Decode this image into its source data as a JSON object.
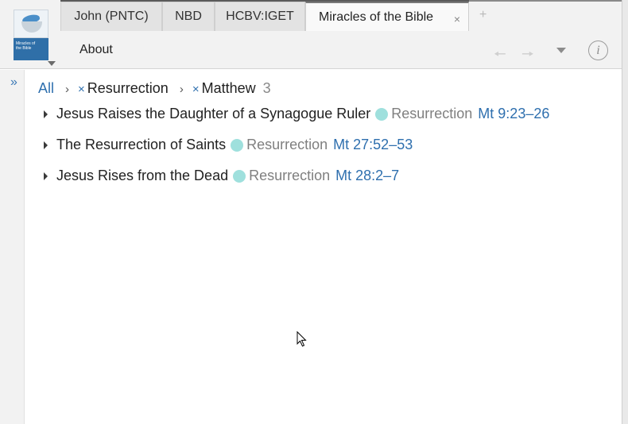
{
  "tabs": [
    {
      "label": "John (PNTC)"
    },
    {
      "label": "NBD"
    },
    {
      "label": "HCBV:IGET"
    },
    {
      "label": "Miracles of the Bible",
      "close": "×"
    }
  ],
  "new_tab": "+",
  "resource_cover": {
    "line1": "Miracles of",
    "line2": "the Bible"
  },
  "toolbar": {
    "about": "About",
    "info": "i"
  },
  "rail": {
    "expand": "»"
  },
  "breadcrumb": {
    "all": "All",
    "sep1": "›",
    "filter1_remove": "×",
    "filter1": "Resurrection",
    "sep2": "›",
    "filter2_remove": "×",
    "filter2": "Matthew",
    "count": "3"
  },
  "results": [
    {
      "title": "Jesus Raises the Daughter of a Synagogue Ruler",
      "category": "Resurrection",
      "reference": "Mt 9:23–26"
    },
    {
      "title": "The Resurrection of Saints",
      "category": "Resurrection",
      "reference": "Mt 27:52–53"
    },
    {
      "title": "Jesus Rises from the Dead",
      "category": "Resurrection",
      "reference": "Mt 28:2–7"
    }
  ],
  "colors": {
    "accent": "#2e6fae",
    "category_dot": "#9fe0dd"
  }
}
